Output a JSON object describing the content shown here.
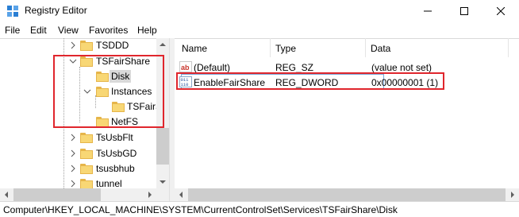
{
  "window": {
    "title": "Registry Editor",
    "app_icon": "registry-editor-icon",
    "controls": [
      "minimize-icon",
      "maximize-icon",
      "close-icon"
    ]
  },
  "menu": [
    "File",
    "Edit",
    "View",
    "Favorites",
    "Help"
  ],
  "tree": {
    "items": [
      {
        "label": "TSDDD",
        "icon": "folder-icon",
        "expander": "chevron-right-icon"
      },
      {
        "label": "TSFairShare",
        "icon": "folder-icon",
        "expander": "chevron-down-icon"
      },
      {
        "label": "Disk",
        "icon": "folder-icon",
        "selected": true
      },
      {
        "label": "Instances",
        "icon": "folder-icon",
        "expander": "chevron-down-icon"
      },
      {
        "label": "TSFairS",
        "icon": "folder-icon"
      },
      {
        "label": "NetFS",
        "icon": "folder-icon"
      },
      {
        "label": "TsUsbFlt",
        "icon": "folder-icon",
        "expander": "chevron-right-icon"
      },
      {
        "label": "TsUsbGD",
        "icon": "folder-icon",
        "expander": "chevron-right-icon"
      },
      {
        "label": "tsusbhub",
        "icon": "folder-icon",
        "expander": "chevron-right-icon"
      },
      {
        "label": "tunnel",
        "icon": "folder-icon",
        "expander": "chevron-right-icon"
      }
    ]
  },
  "list": {
    "columns": [
      "Name",
      "Type",
      "Data"
    ],
    "rows": [
      {
        "name": "(Default)",
        "type": "REG_SZ",
        "data": "(value not set)",
        "icon": "string-value-icon"
      },
      {
        "name": "EnableFairShare",
        "type": "REG_DWORD",
        "data": "0x00000001 (1)",
        "icon": "dword-value-icon"
      }
    ]
  },
  "status": {
    "path": "Computer\\HKEY_LOCAL_MACHINE\\SYSTEM\\CurrentControlSet\\Services\\TSFairShare\\Disk"
  },
  "colors": {
    "highlight": "#e0262d",
    "selection": "#d9d9d9",
    "folder": "#f8d775"
  }
}
